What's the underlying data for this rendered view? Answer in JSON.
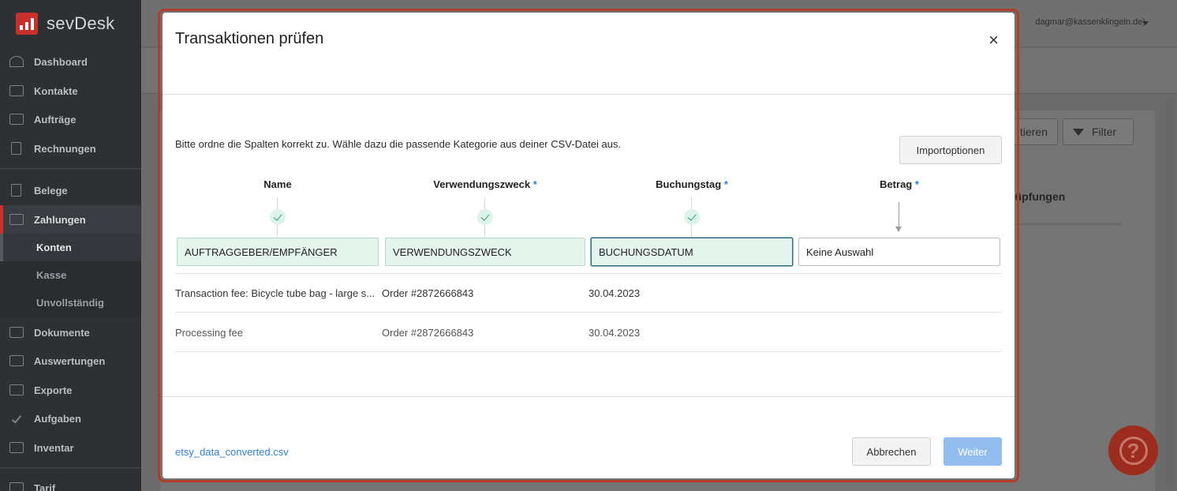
{
  "app": {
    "brand": "sevDesk"
  },
  "sidebar": {
    "items": [
      {
        "label": "Dashboard"
      },
      {
        "label": "Kontakte"
      },
      {
        "label": "Aufträge"
      },
      {
        "label": "Rechnungen"
      },
      {
        "label": "Belege"
      },
      {
        "label": "Zahlungen"
      },
      {
        "label": "Dokumente"
      },
      {
        "label": "Auswertungen"
      },
      {
        "label": "Exporte"
      },
      {
        "label": "Aufgaben"
      },
      {
        "label": "Inventar"
      },
      {
        "label": "Tarif"
      }
    ],
    "subitems": [
      {
        "label": "Konten"
      },
      {
        "label": "Kasse"
      },
      {
        "label": "Unvollständig"
      }
    ]
  },
  "background": {
    "account": "dagmar@kassenklingeln.de)",
    "btn_partial": "tieren",
    "filter_label": "Filter",
    "column_heading": "nüpfungen"
  },
  "modal": {
    "title": "Transaktionen prüfen",
    "close_symbol": "×",
    "intro": "Bitte ordne die Spalten korrekt zu. Wähle dazu die passende Kategorie aus deiner CSV-Datei aus.",
    "import_options_label": "Importoptionen",
    "required_marker": "*",
    "columns": [
      {
        "label": "Name",
        "required": false,
        "selected": "AUFTRAGGEBER/EMPFÄNGER"
      },
      {
        "label": "Verwendungszweck",
        "required": true,
        "selected": "VERWENDUNGSZWECK"
      },
      {
        "label": "Buchungstag",
        "required": true,
        "selected": "BUCHUNGSDATUM"
      },
      {
        "label": "Betrag",
        "required": true,
        "selected": "Keine Auswahl"
      }
    ],
    "rows": [
      {
        "name": "Transaction fee: Bicycle tube bag - large s...",
        "purpose": "Order #2872666843",
        "date": "30.04.2023"
      },
      {
        "name": "Processing fee",
        "purpose": "Order #2872666843",
        "date": "30.04.2023"
      }
    ],
    "file_name": "etsy_data_converted.csv",
    "cancel_label": "Abbrechen",
    "next_label": "Weiter"
  },
  "help": {
    "symbol": "?"
  },
  "colors": {
    "accent_red": "#c9302c",
    "primary_blue": "#2f7fd8",
    "mapped_green": "#e4f5ee"
  }
}
